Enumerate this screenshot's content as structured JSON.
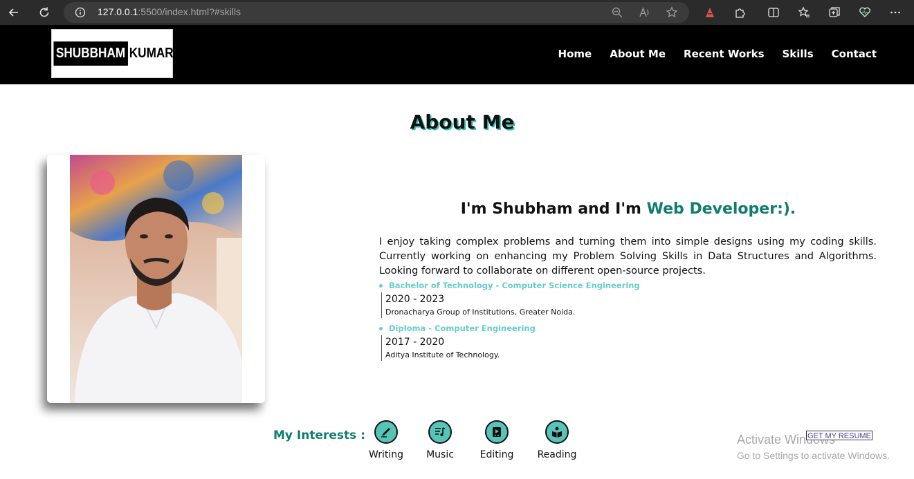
{
  "browser": {
    "url_host": "127.0.0.1",
    "url_rest": ":5500/index.html?#skills"
  },
  "header": {
    "logo_part1": "SHUBBHAM",
    "logo_part2": "KUMAR",
    "nav": [
      "Home",
      "About Me",
      "Recent Works",
      "Skills",
      "Contact"
    ]
  },
  "about": {
    "title": "About Me",
    "intro_prefix": "I'm Shubham and I'm ",
    "intro_accent": "Web Developer:).",
    "paragraph": "I enjoy taking complex problems and turning them into simple designs using my coding skills. Currently working on enhancing my Problem Solving Skills in Data Structures and Algorithms. Looking forward to collaborate on different open-source projects.",
    "education": [
      {
        "degree": "Bachelor of Technology - Computer Science Engineering",
        "years": "2020 - 2023",
        "institution": "Dronacharya Group of Institutions, Greater Noida."
      },
      {
        "degree": "Diploma - Computer Engineering",
        "years": "2017 - 2020",
        "institution": "Aditya Institute of Technology."
      }
    ]
  },
  "interests": {
    "label": "My Interests :",
    "items": [
      {
        "label": "Writing",
        "icon": "writing-icon"
      },
      {
        "label": "Music",
        "icon": "music-icon"
      },
      {
        "label": "Editing",
        "icon": "editing-icon"
      },
      {
        "label": "Reading",
        "icon": "reading-icon"
      }
    ]
  },
  "resume_button": "GET MY RESUME",
  "watermark": {
    "line1": "Activate Windows",
    "line2": "Go to Settings to activate Windows."
  },
  "colors": {
    "accent": "#0e7c6e",
    "light_accent": "#66cdc7",
    "header_bg": "#000000"
  }
}
